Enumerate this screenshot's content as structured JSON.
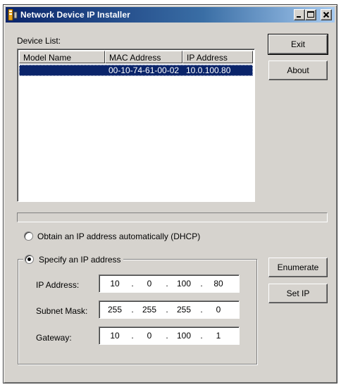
{
  "window": {
    "title": "Network Device IP Installer"
  },
  "device_list": {
    "label": "Device List:",
    "columns": [
      "Model Name",
      "MAC Address",
      "IP Address"
    ],
    "rows": [
      {
        "model": "",
        "mac": "00-10-74-61-00-02",
        "ip": "10.0.100.80"
      }
    ]
  },
  "buttons": {
    "exit": "Exit",
    "about": "About",
    "enumerate": "Enumerate",
    "set_ip": "Set IP"
  },
  "progress": {
    "value": 0
  },
  "ip_mode": {
    "dhcp_label": "Obtain an IP address automatically (DHCP)",
    "static_label": "Specify an IP address",
    "selected": "static"
  },
  "fields": {
    "ip_label": "IP Address:",
    "subnet_label": "Subnet Mask:",
    "gateway_label": "Gateway:",
    "ip": [
      "10",
      "0",
      "100",
      "80"
    ],
    "subnet": [
      "255",
      "255",
      "255",
      "0"
    ],
    "gateway": [
      "10",
      "0",
      "100",
      "1"
    ],
    "separator": "."
  },
  "colors": {
    "window_bg": "#d6d3ce",
    "title_start": "#0a246a",
    "title_end": "#a6caf0",
    "selection": "#0a246a"
  },
  "icons": {
    "app": "network-device-app-icon",
    "minimize": "minimize-icon",
    "maximize": "maximize-icon",
    "close": "close-icon"
  }
}
